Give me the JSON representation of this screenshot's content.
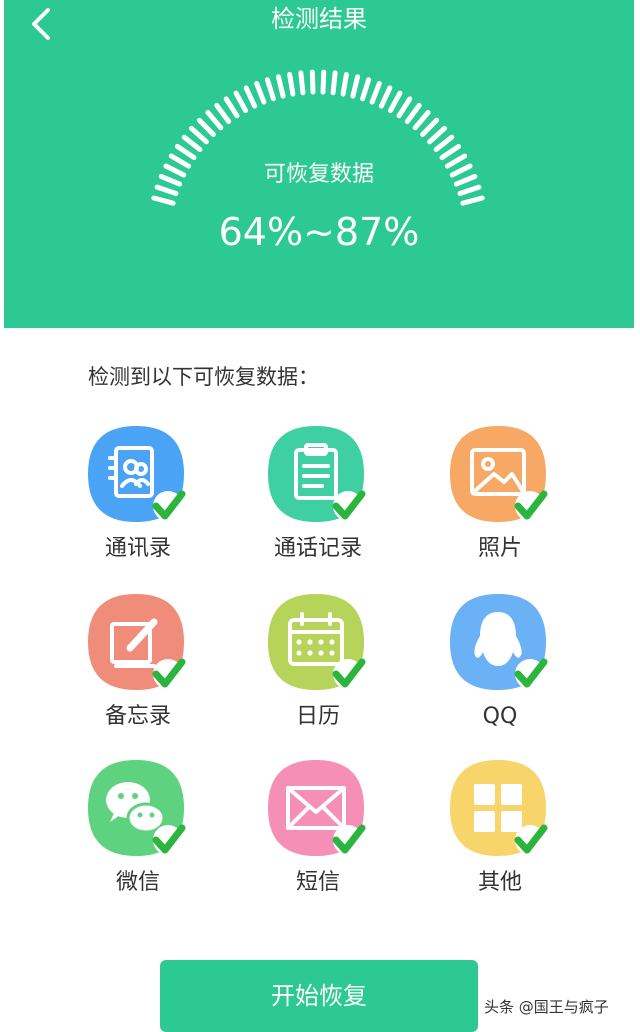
{
  "header": {
    "title": "检测结果",
    "back_icon": "chevron-left-icon",
    "background_color": "#2cc993",
    "gauge": {
      "label": "可恢复数据",
      "range_text": "64%~87%",
      "range_low": 0.64,
      "range_high": 0.87
    }
  },
  "section": {
    "title": "检测到以下可恢复数据："
  },
  "items": [
    {
      "label": "通讯录",
      "icon": "contacts-icon",
      "color": "#4aa3f5",
      "checked": true
    },
    {
      "label": "通话记录",
      "icon": "call-log-icon",
      "color": "#3ecfa3",
      "checked": true
    },
    {
      "label": "照片",
      "icon": "photo-icon",
      "color": "#f7a865",
      "checked": true
    },
    {
      "label": "备忘录",
      "icon": "memo-icon",
      "color": "#f08c7a",
      "checked": true
    },
    {
      "label": "日历",
      "icon": "calendar-icon",
      "color": "#b6d35a",
      "checked": true
    },
    {
      "label": "QQ",
      "icon": "qq-icon",
      "color": "#6bb1f5",
      "checked": true
    },
    {
      "label": "微信",
      "icon": "wechat-icon",
      "color": "#5fd27f",
      "checked": true
    },
    {
      "label": "短信",
      "icon": "sms-icon",
      "color": "#f58fb6",
      "checked": true
    },
    {
      "label": "其他",
      "icon": "other-grid-icon",
      "color": "#f7d56b",
      "checked": true
    }
  ],
  "check_color": "#2bb53f",
  "start_button": {
    "label": "开始恢复"
  },
  "watermark": "头条 @国王与疯子"
}
